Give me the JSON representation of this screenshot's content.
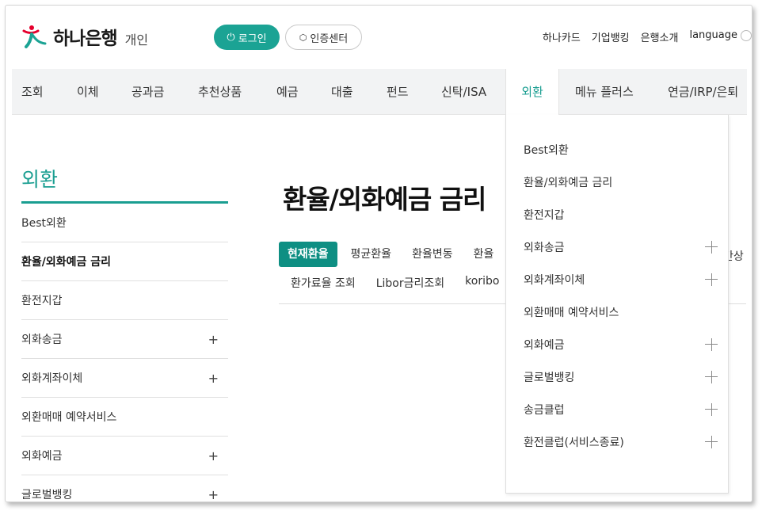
{
  "header": {
    "logo_text": "하나은행",
    "logo_sub": "개인",
    "login_label": "로그인",
    "cert_label": "인증센터",
    "util_links": [
      "하나카드",
      "기업뱅킹",
      "은행소개",
      "language"
    ],
    "brand_color": "#1ba394"
  },
  "gnb": {
    "items": [
      "조회",
      "이체",
      "공과금",
      "추천상품",
      "예금",
      "대출",
      "펀드",
      "신탁/ISA",
      "외환",
      "메뉴 플러스",
      "연금/IRP/은퇴"
    ],
    "active": "외환"
  },
  "sidebar": {
    "title": "외환",
    "items": [
      {
        "label": "Best외환",
        "expandable": false
      },
      {
        "label": "환율/외화예금 금리",
        "expandable": false,
        "current": true
      },
      {
        "label": "환전지갑",
        "expandable": false
      },
      {
        "label": "외화송금",
        "expandable": true
      },
      {
        "label": "외화계좌이체",
        "expandable": true
      },
      {
        "label": "외환매매 예약서비스",
        "expandable": false
      },
      {
        "label": "외화예금",
        "expandable": true
      },
      {
        "label": "글로벌뱅킹",
        "expandable": true
      }
    ],
    "plus_glyph": "+"
  },
  "main": {
    "title": "환율/외화예금 금리",
    "tabs_row1": [
      "현재환율",
      "평균환율",
      "환율변동",
      "환율"
    ],
    "tabs_row2": [
      "환가료율 조회",
      "Libor금리조회",
      "koribo"
    ],
    "edge_text": "간상"
  },
  "dropdown": {
    "items": [
      {
        "label": "Best외환",
        "expandable": false
      },
      {
        "label": "환율/외화예금 금리",
        "expandable": false
      },
      {
        "label": "환전지갑",
        "expandable": false
      },
      {
        "label": "외화송금",
        "expandable": true
      },
      {
        "label": "외화계좌이체",
        "expandable": true
      },
      {
        "label": "외환매매 예약서비스",
        "expandable": false
      },
      {
        "label": "외화예금",
        "expandable": true
      },
      {
        "label": "글로벌뱅킹",
        "expandable": true
      },
      {
        "label": "송금클럽",
        "expandable": true
      },
      {
        "label": "환전클럽(서비스종료)",
        "expandable": true
      }
    ]
  }
}
